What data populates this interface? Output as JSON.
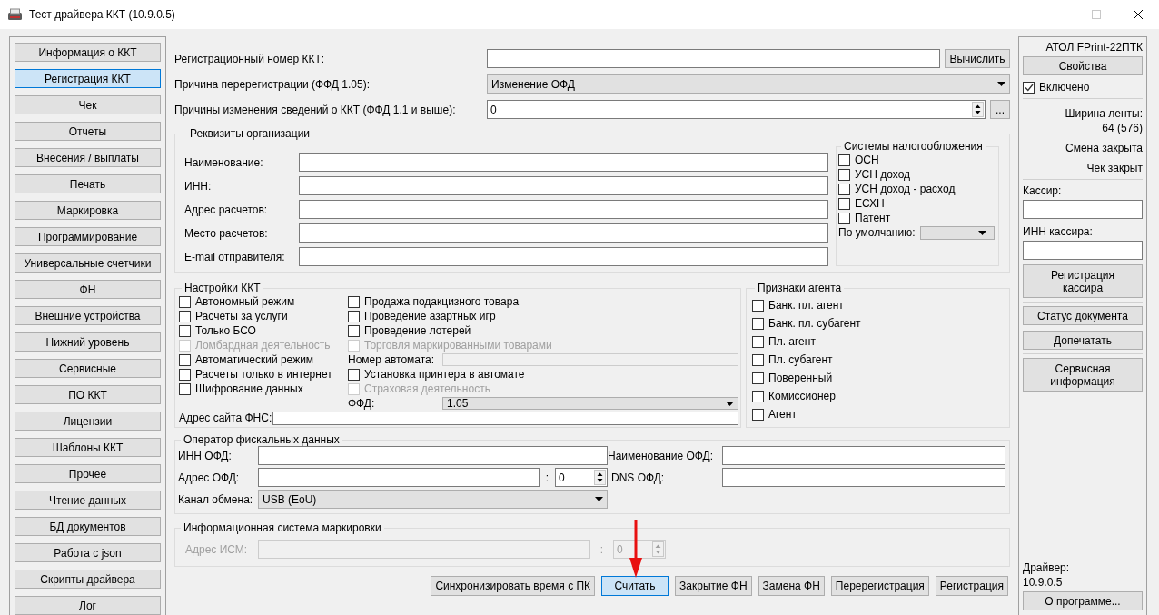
{
  "window": {
    "title": "Тест драйвера ККТ (10.9.0.5)"
  },
  "nav": [
    {
      "label": "Информация о ККТ",
      "selected": false
    },
    {
      "label": "Регистрация ККТ",
      "selected": true
    },
    {
      "label": "Чек",
      "selected": false
    },
    {
      "label": "Отчеты",
      "selected": false
    },
    {
      "label": "Внесения / выплаты",
      "selected": false
    },
    {
      "label": "Печать",
      "selected": false
    },
    {
      "label": "Маркировка",
      "selected": false
    },
    {
      "label": "Программирование",
      "selected": false
    },
    {
      "label": "Универсальные счетчики",
      "selected": false
    },
    {
      "label": "ФН",
      "selected": false
    },
    {
      "label": "Внешние устройства",
      "selected": false
    },
    {
      "label": "Нижний уровень",
      "selected": false
    },
    {
      "label": "Сервисные",
      "selected": false
    },
    {
      "label": "ПО ККТ",
      "selected": false
    },
    {
      "label": "Лицензии",
      "selected": false
    },
    {
      "label": "Шаблоны ККТ",
      "selected": false
    },
    {
      "label": "Прочее",
      "selected": false
    },
    {
      "label": "Чтение данных",
      "selected": false
    },
    {
      "label": "БД документов",
      "selected": false
    },
    {
      "label": "Работа с json",
      "selected": false
    },
    {
      "label": "Скрипты драйвера",
      "selected": false
    },
    {
      "label": "Лог",
      "selected": false
    }
  ],
  "top_fields": [
    {
      "kind": "text",
      "label": "Регистрационный номер ККТ:",
      "button": "Вычислить"
    },
    {
      "kind": "select",
      "label": "Причина перерегистрации (ФФД 1.05):",
      "value": "Изменение ОФД"
    },
    {
      "kind": "spin",
      "label": "Причины изменения сведений о ККТ (ФФД 1.1 и выше):",
      "value": "0",
      "button": "..."
    }
  ],
  "organization": {
    "title": "Реквизиты организации",
    "fields": [
      "Наименование:",
      "ИНН:",
      "Адрес расчетов:",
      "Место расчетов:",
      "E-mail отправителя:"
    ],
    "tax": {
      "title": "Системы налогообложения",
      "options": [
        {
          "label": "ОСН",
          "checked": false
        },
        {
          "label": "УСН доход",
          "checked": false
        },
        {
          "label": "УСН доход - расход",
          "checked": false
        },
        {
          "label": "ЕСХН",
          "checked": false
        },
        {
          "label": "Патент",
          "checked": false
        }
      ],
      "default_label": "По умолчанию:"
    }
  },
  "settings": {
    "title": "Настройки ККТ",
    "left": [
      {
        "kind": "checkbox",
        "label": "Автономный режим",
        "checked": false,
        "disabled": false
      },
      {
        "kind": "checkbox",
        "label": "Расчеты за услуги",
        "checked": false,
        "disabled": false
      },
      {
        "kind": "checkbox",
        "label": "Только БСО",
        "checked": false,
        "disabled": false
      },
      {
        "kind": "checkbox",
        "label": "Ломбардная деятельность",
        "checked": false,
        "disabled": true
      },
      {
        "kind": "checkbox",
        "label": "Автоматический режим",
        "checked": false,
        "disabled": false
      },
      {
        "kind": "checkbox",
        "label": "Расчеты только в интернет",
        "checked": false,
        "disabled": false
      },
      {
        "kind": "checkbox",
        "label": "Шифрование данных",
        "checked": false,
        "disabled": false
      }
    ],
    "right": [
      {
        "kind": "checkbox",
        "label": "Продажа подакцизного товара",
        "checked": false,
        "disabled": false
      },
      {
        "kind": "checkbox",
        "label": "Проведение азартных игр",
        "checked": false,
        "disabled": false
      },
      {
        "kind": "checkbox",
        "label": "Проведение лотерей",
        "checked": false,
        "disabled": false
      },
      {
        "kind": "checkbox",
        "label": "Торговля маркированными товарами",
        "checked": false,
        "disabled": true
      },
      {
        "kind": "field",
        "label": "Номер автомата:",
        "disabled": true
      },
      {
        "kind": "checkbox",
        "label": "Установка принтера в автомате",
        "checked": false,
        "disabled": false
      },
      {
        "kind": "checkbox",
        "label": "Страховая деятельность",
        "checked": false,
        "disabled": true
      },
      {
        "kind": "select",
        "label": "ФФД:",
        "value": "1.05",
        "disabled": false
      }
    ],
    "site_label": "Адрес сайта ФНС:"
  },
  "agent": {
    "title": "Признаки агента",
    "options": [
      {
        "label": "Банк. пл. агент",
        "checked": false
      },
      {
        "label": "Банк. пл. субагент",
        "checked": false
      },
      {
        "label": "Пл. агент",
        "checked": false
      },
      {
        "label": "Пл. субагент",
        "checked": false
      },
      {
        "label": "Поверенный",
        "checked": false
      },
      {
        "label": "Комиссионер",
        "checked": false
      },
      {
        "label": "Агент",
        "checked": false
      }
    ]
  },
  "ofd": {
    "title": "Оператор фискальных данных",
    "inn_label": "ИНН ОФД:",
    "name_label": "Наименование ОФД:",
    "address_label": "Адрес ОФД:",
    "port_separator": ":",
    "port_value": "0",
    "dns_label": "DNS ОФД:",
    "channel_label": "Канал обмена:",
    "channel_value": "USB (EoU)"
  },
  "ism": {
    "title": "Информационная система маркировки",
    "address_label": "Адрес ИСМ:",
    "port_separator": ":",
    "port_value": "0",
    "disabled": true
  },
  "bottom_buttons": [
    {
      "label": "Синхронизировать время с ПК",
      "focused": false
    },
    {
      "label": "Считать",
      "focused": true
    },
    {
      "label": "Закрытие ФН",
      "focused": false
    },
    {
      "label": "Замена ФН",
      "focused": false
    },
    {
      "label": "Перерегистрация",
      "focused": false
    },
    {
      "label": "Регистрация",
      "focused": false
    }
  ],
  "device": {
    "model": "АТОЛ FPrint-22ПТК",
    "properties_button": "Свойства",
    "enabled": {
      "label": "Включено",
      "checked": true
    },
    "tape_width_label": "Ширина ленты:",
    "tape_width": "64 (576)",
    "shift_status": "Смена закрыта",
    "receipt_status": "Чек закрыт",
    "cashier_label": "Кассир:",
    "cashier_inn_label": "ИНН кассира:",
    "cashier_button": "Регистрация кассира",
    "status_buttons": [
      "Статус документа",
      "Допечатать"
    ],
    "service_button": "Сервисная информация",
    "driver_label": "Драйвер:",
    "driver_version": "10.9.0.5",
    "about_button": "О программе..."
  }
}
